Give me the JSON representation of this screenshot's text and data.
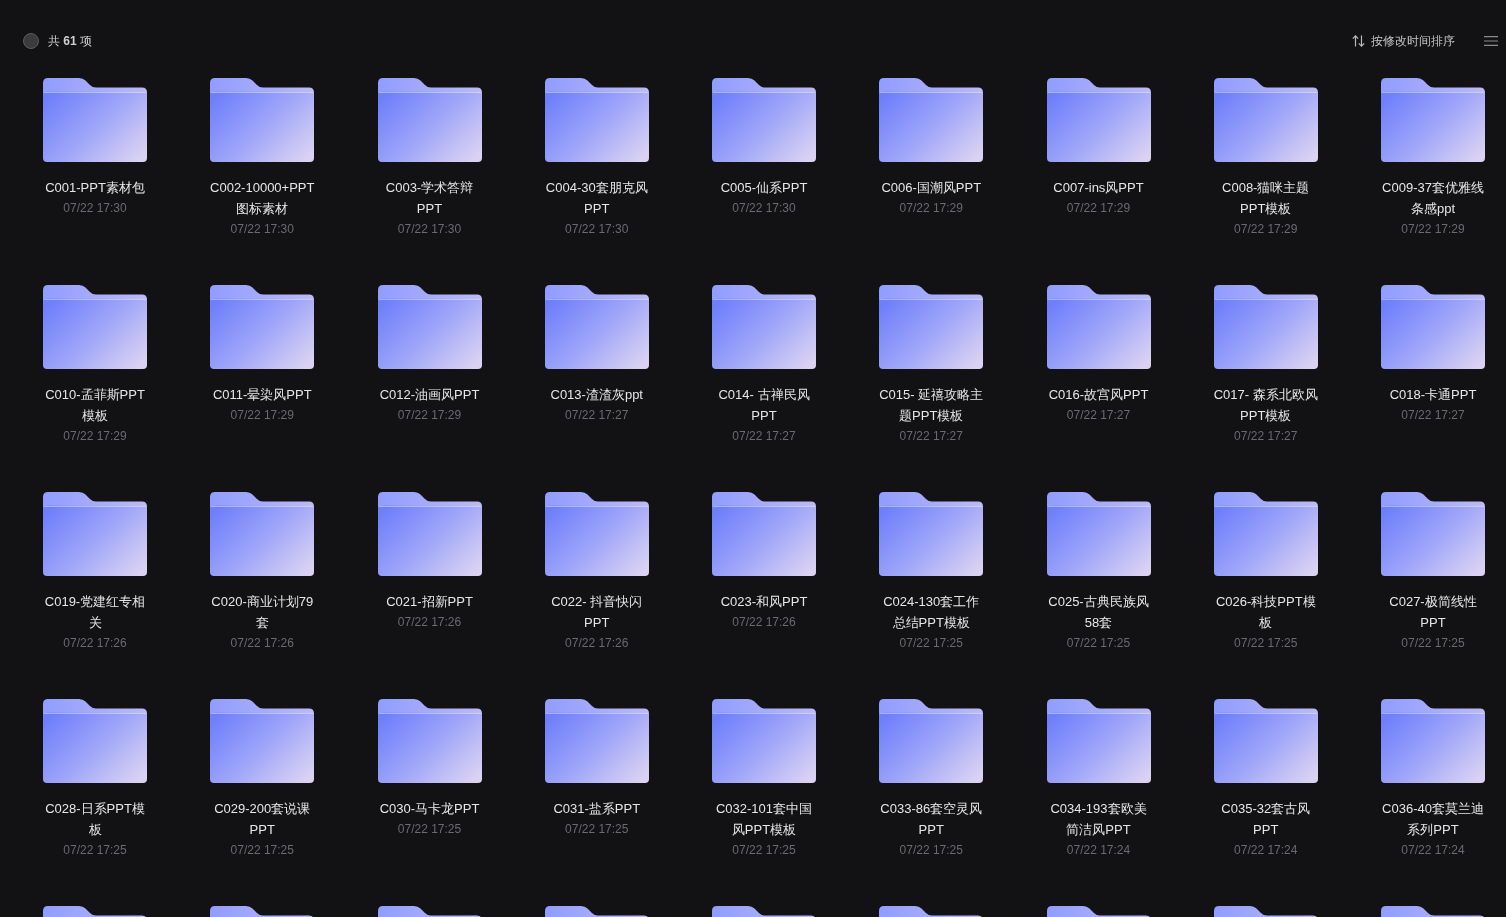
{
  "toolbar": {
    "select_all": {
      "checked": false
    },
    "count_label": "共 **61** 项",
    "sort_label": "按修改时间排序"
  },
  "items": [
    {
      "kind": "folder",
      "name": "C001-PPT素材包",
      "date": "07/22 17:30"
    },
    {
      "kind": "folder",
      "name": "C002-10000+PPT图标素材",
      "date": "07/22 17:30"
    },
    {
      "kind": "folder",
      "name": "C003-学术答辩PPT",
      "date": "07/22 17:30"
    },
    {
      "kind": "folder",
      "name": "C004-30套朋克风PPT",
      "date": "07/22 17:30"
    },
    {
      "kind": "folder",
      "name": "C005-仙系PPT",
      "date": "07/22 17:30"
    },
    {
      "kind": "folder",
      "name": "C006-国潮风PPT",
      "date": "07/22 17:29"
    },
    {
      "kind": "folder",
      "name": "C007-ins风PPT",
      "date": "07/22 17:29"
    },
    {
      "kind": "folder",
      "name": "C008-猫咪主题PPT模板",
      "date": "07/22 17:29"
    },
    {
      "kind": "folder",
      "name": "C009-37套优雅线条感ppt",
      "date": "07/22 17:29"
    },
    {
      "kind": "folder",
      "name": "C010-孟菲斯PPT模板",
      "date": "07/22 17:29"
    },
    {
      "kind": "folder",
      "name": "C011-晕染风PPT",
      "date": "07/22 17:29"
    },
    {
      "kind": "folder",
      "name": "C012-油画风PPT",
      "date": "07/22 17:29"
    },
    {
      "kind": "folder",
      "name": "C013-渣渣灰ppt",
      "date": "07/22 17:27"
    },
    {
      "kind": "folder",
      "name": "C014- 古禅民风PPT",
      "date": "07/22 17:27"
    },
    {
      "kind": "folder",
      "name": "C015- 延禧攻略主题PPT模板",
      "date": "07/22 17:27"
    },
    {
      "kind": "folder",
      "name": "C016-故宫风PPT",
      "date": "07/22 17:27"
    },
    {
      "kind": "folder",
      "name": "C017- 森系北欧风PPT模板",
      "date": "07/22 17:27"
    },
    {
      "kind": "folder",
      "name": "C018-卡通PPT",
      "date": "07/22 17:27"
    },
    {
      "kind": "folder",
      "name": "C019-党建红专相关",
      "date": "07/22 17:26"
    },
    {
      "kind": "folder",
      "name": "C020-商业计划79套",
      "date": "07/22 17:26"
    },
    {
      "kind": "folder",
      "name": "C021-招新PPT",
      "date": "07/22 17:26"
    },
    {
      "kind": "folder",
      "name": "C022- 抖音快闪PPT",
      "date": "07/22 17:26"
    },
    {
      "kind": "folder",
      "name": "C023-和风PPT",
      "date": "07/22 17:26"
    },
    {
      "kind": "folder",
      "name": "C024-130套工作总结PPT模板",
      "date": "07/22 17:25"
    },
    {
      "kind": "folder",
      "name": "C025-古典民族风58套",
      "date": "07/22 17:25"
    },
    {
      "kind": "folder",
      "name": "C026-科技PPT模板",
      "date": "07/22 17:25"
    },
    {
      "kind": "folder",
      "name": "C027-极简线性PPT",
      "date": "07/22 17:25"
    },
    {
      "kind": "folder",
      "name": "C028-日系PPT模板",
      "date": "07/22 17:25"
    },
    {
      "kind": "folder",
      "name": "C029-200套说课PPT",
      "date": "07/22 17:25"
    },
    {
      "kind": "folder",
      "name": "C030-马卡龙PPT",
      "date": "07/22 17:25"
    },
    {
      "kind": "folder",
      "name": "C031-盐系PPT",
      "date": "07/22 17:25"
    },
    {
      "kind": "folder",
      "name": "C032-101套中国风PPT模板",
      "date": "07/22 17:25"
    },
    {
      "kind": "folder",
      "name": "C033-86套空灵风PPT",
      "date": "07/22 17:25"
    },
    {
      "kind": "folder",
      "name": "C034-193套欧美简洁风PPT",
      "date": "07/22 17:24"
    },
    {
      "kind": "folder",
      "name": "C035-32套古风PPT",
      "date": "07/22 17:24"
    },
    {
      "kind": "folder",
      "name": "C036-40套莫兰迪系列PPT",
      "date": "07/22 17:24"
    },
    {
      "kind": "folder"
    },
    {
      "kind": "folder"
    },
    {
      "kind": "folder"
    },
    {
      "kind": "folder"
    },
    {
      "kind": "folder"
    },
    {
      "kind": "folder"
    },
    {
      "kind": "folder"
    },
    {
      "kind": "folder"
    },
    {
      "kind": "folder"
    }
  ]
}
